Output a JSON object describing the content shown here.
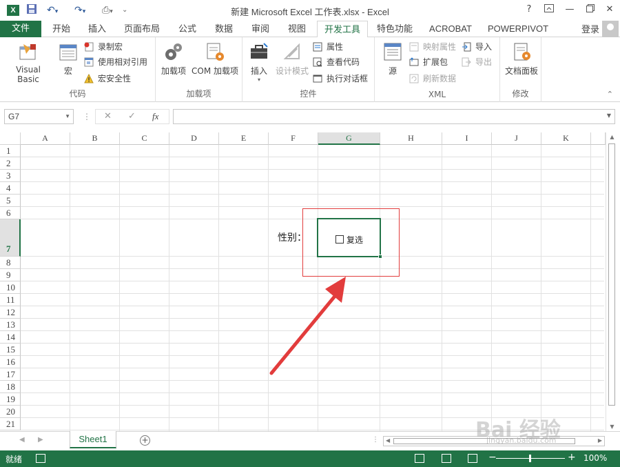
{
  "title_bar": {
    "app_icon": "X",
    "title": "新建 Microsoft Excel 工作表.xlsx - Excel",
    "help": "?",
    "minimize": "—",
    "close": "✕"
  },
  "tabs": {
    "file": "文件",
    "items": [
      "开始",
      "插入",
      "页面布局",
      "公式",
      "数据",
      "审阅",
      "视图",
      "开发工具",
      "特色功能",
      "ACROBAT",
      "POWERPIVOT"
    ],
    "active": "开发工具",
    "login": "登录"
  },
  "ribbon": {
    "code": {
      "label": "代码",
      "visual_basic": "Visual Basic",
      "macros": "宏",
      "record_macro": "录制宏",
      "relative_ref": "使用相对引用",
      "macro_security": "宏安全性"
    },
    "addins": {
      "label": "加载项",
      "addins": "加载项",
      "com_addins": "COM 加载项"
    },
    "controls": {
      "label": "控件",
      "insert": "插入",
      "design_mode": "设计模式",
      "properties": "属性",
      "view_code": "查看代码",
      "run_dialog": "执行对话框"
    },
    "xml": {
      "label": "XML",
      "source": "源",
      "map_properties": "映射属性",
      "expansion_packs": "扩展包",
      "refresh_data": "刷新数据",
      "import": "导入",
      "export": "导出"
    },
    "modify": {
      "label": "修改",
      "doc_panel": "文档面板"
    }
  },
  "formula_bar": {
    "name_box": "G7",
    "cancel": "✕",
    "enter": "✓",
    "fx": "fx",
    "value": ""
  },
  "sheet": {
    "columns": [
      "A",
      "B",
      "C",
      "D",
      "E",
      "F",
      "G",
      "H",
      "I",
      "J",
      "K"
    ],
    "rows": [
      "1",
      "2",
      "3",
      "4",
      "5",
      "6",
      "7",
      "8",
      "9",
      "10",
      "11",
      "12",
      "13",
      "14",
      "15",
      "16",
      "17",
      "18",
      "19",
      "20",
      "21"
    ],
    "selected_cell": "G7",
    "cell_f7": "性别：",
    "checkbox_label": "复选"
  },
  "sheet_tabs": {
    "active": "Sheet1",
    "add": "+"
  },
  "status_bar": {
    "status": "就绪",
    "zoom_minus": "−",
    "zoom_plus": "+",
    "zoom": "100%",
    "zoom_fraction": 0.5
  },
  "watermark": {
    "brand": "Bai 经验",
    "url": "jingyan.baidu.com"
  },
  "colors": {
    "accent": "#217346",
    "highlight": "#e23c3c"
  }
}
